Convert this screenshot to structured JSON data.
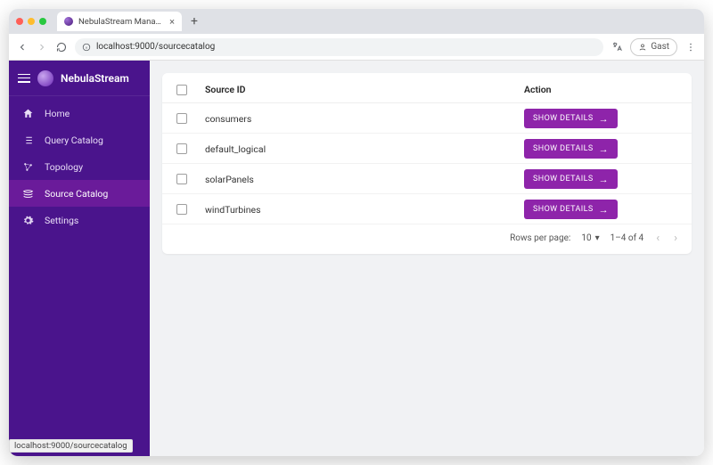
{
  "browser": {
    "tab_title": "NebulaStream Management",
    "url": "localhost:9000/sourcecatalog",
    "guest_label": "Gast",
    "status_url": "localhost:9000/sourcecatalog"
  },
  "brand": {
    "name": "NebulaStream"
  },
  "sidebar": {
    "items": [
      {
        "label": "Home",
        "icon": "home-icon",
        "active": false
      },
      {
        "label": "Query Catalog",
        "icon": "list-icon",
        "active": false
      },
      {
        "label": "Topology",
        "icon": "topology-icon",
        "active": false
      },
      {
        "label": "Source Catalog",
        "icon": "layers-icon",
        "active": true
      },
      {
        "label": "Settings",
        "icon": "gear-icon",
        "active": false
      }
    ]
  },
  "table": {
    "columns": {
      "id": "Source ID",
      "action": "Action"
    },
    "action_label": "SHOW DETAILS",
    "rows": [
      {
        "id": "consumers"
      },
      {
        "id": "default_logical"
      },
      {
        "id": "solarPanels"
      },
      {
        "id": "windTurbines"
      }
    ],
    "pager": {
      "rows_per_page_label": "Rows per page:",
      "rows_per_page_value": "10",
      "range": "1–4 of 4"
    }
  },
  "colors": {
    "sidebar": "#4a148c",
    "sidebar_active": "#6a1b9a",
    "accent": "#8e24aa"
  }
}
